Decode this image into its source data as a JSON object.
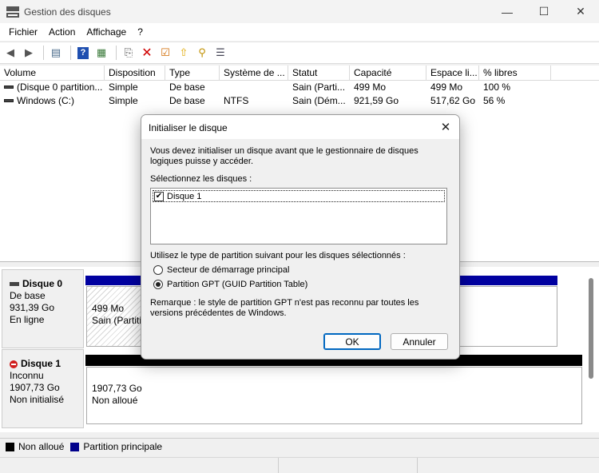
{
  "window": {
    "title": "Gestion des disques",
    "controls": [
      "—",
      "☐",
      "✕"
    ]
  },
  "menu": [
    "Fichier",
    "Action",
    "Affichage",
    "?"
  ],
  "list": {
    "columns": [
      "Volume",
      "Disposition",
      "Type",
      "Système de ...",
      "Statut",
      "Capacité",
      "Espace li...",
      "% libres"
    ],
    "rows": [
      [
        "(Disque 0 partition...",
        "Simple",
        "De base",
        "",
        "Sain (Parti...",
        "499 Mo",
        "499 Mo",
        "100 %"
      ],
      [
        "Windows (C:)",
        "Simple",
        "De base",
        "NTFS",
        "Sain (Dém...",
        "921,59 Go",
        "517,62 Go",
        "56 %"
      ]
    ]
  },
  "disks": [
    {
      "name": "Disque 0",
      "type": "De base",
      "size": "931,39 Go",
      "state": "En ligne",
      "partition_size": "499 Mo",
      "partition_status": "Sain (Partition"
    },
    {
      "name": "Disque 1",
      "type": "Inconnu",
      "size": "1907,73 Go",
      "state": "Non initialisé",
      "partition_size": "1907,73 Go",
      "partition_status": "Non alloué"
    }
  ],
  "legend": [
    {
      "label": "Non alloué",
      "color": "#000000"
    },
    {
      "label": "Partition principale",
      "color": "#00008b"
    }
  ],
  "dialog": {
    "title": "Initialiser le disque",
    "intro": "Vous devez initialiser un disque avant que le gestionnaire de disques logiques puisse y accéder.",
    "select_label": "Sélectionnez les disques :",
    "disk_item": "Disque 1",
    "partition_label": "Utilisez le type de partition suivant pour les disques sélectionnés :",
    "option_mbr": "Secteur de démarrage principal",
    "option_gpt": "Partition GPT (GUID Partition Table)",
    "selected_option": "gpt",
    "remark": "Remarque : le style de partition GPT n'est pas reconnu par toutes les versions précédentes de Windows.",
    "ok": "OK",
    "cancel": "Annuler"
  },
  "colors": {
    "accent": "#0067c0",
    "primary_partition": "#0000a0",
    "unallocated": "#000000"
  }
}
